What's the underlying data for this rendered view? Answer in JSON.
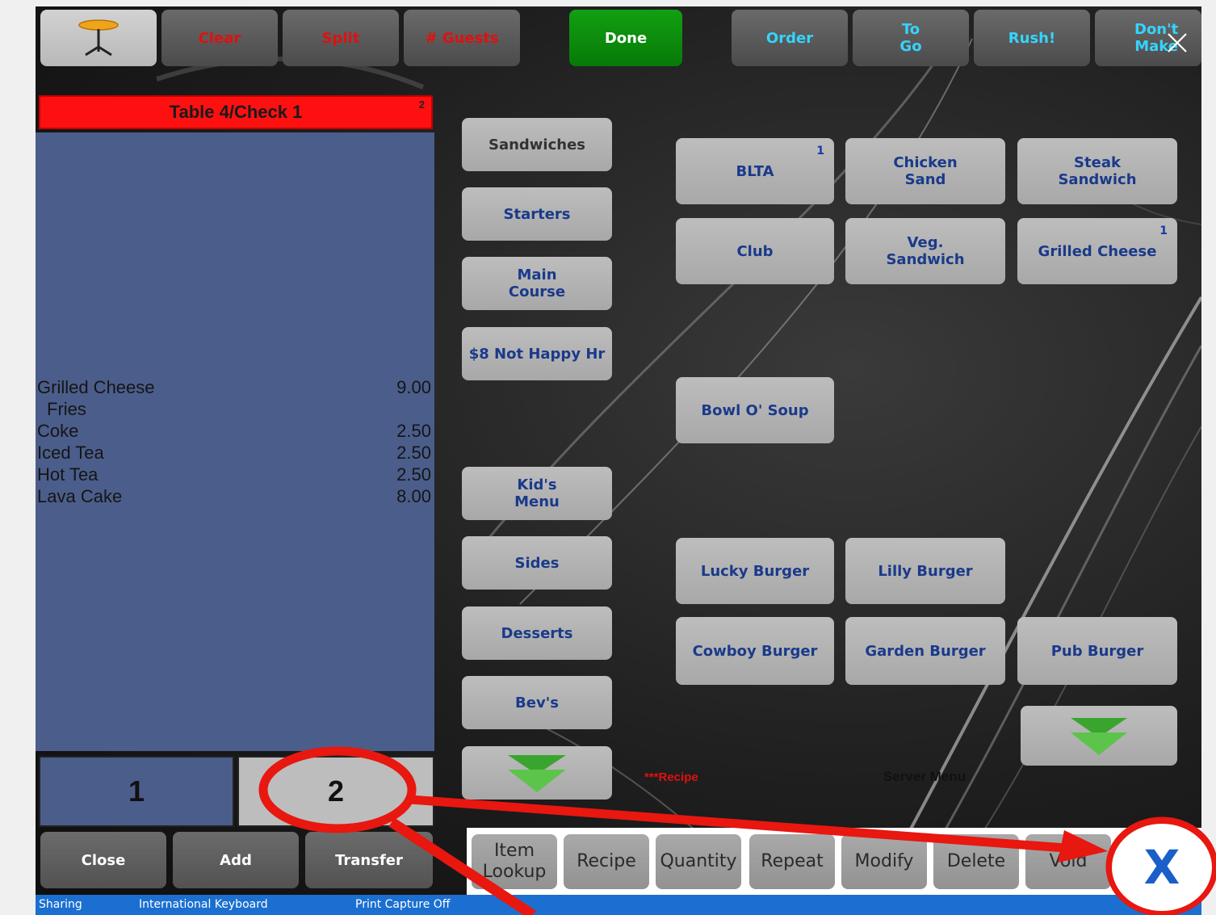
{
  "top_bar": {
    "clear": "Clear",
    "split": "Split",
    "guests": "# Guests",
    "done": "Done",
    "order": "Order",
    "to_go": "To\nGo",
    "rush": "Rush!",
    "dont_make": "Don't\nMake"
  },
  "check": {
    "title": "Table 4/Check 1",
    "seat_count": "2",
    "items": [
      {
        "name": "Grilled Cheese",
        "price": "9.00"
      },
      {
        "name": "Fries",
        "price": ""
      },
      {
        "name": "Coke",
        "price": "2.50"
      },
      {
        "name": "Iced Tea",
        "price": "2.50"
      },
      {
        "name": "Hot Tea",
        "price": "2.50"
      },
      {
        "name": "Lava Cake",
        "price": "8.00"
      }
    ],
    "seats": [
      "1",
      "2"
    ],
    "actions": {
      "close": "Close",
      "add": "Add",
      "transfer": "Transfer"
    }
  },
  "categories": [
    "Sandwiches",
    "Starters",
    "Main\nCourse",
    "$8 Not Happy Hr",
    "Kid's\nMenu",
    "Sides",
    "Desserts",
    "Bev's"
  ],
  "menu_items": {
    "blta": {
      "label": "BLTA",
      "badge": "1"
    },
    "chicken_sand": {
      "label": "Chicken\nSand"
    },
    "steak_sandwich": {
      "label": "Steak\nSandwich"
    },
    "club": {
      "label": "Club"
    },
    "veg_sandwich": {
      "label": "Veg.\nSandwich"
    },
    "grilled_cheese": {
      "label": "Grilled Cheese",
      "badge": "1"
    },
    "bowl_soup": {
      "label": "Bowl O' Soup"
    },
    "lucky_burger": {
      "label": "Lucky Burger"
    },
    "lilly_burger": {
      "label": "Lilly Burger"
    },
    "cowboy_burger": {
      "label": "Cowboy Burger"
    },
    "garden_burger": {
      "label": "Garden Burger"
    },
    "pub_burger": {
      "label": "Pub Burger"
    }
  },
  "labels": {
    "recipe": "***Recipe",
    "server_menu": "Server Menu"
  },
  "toolbar": {
    "item_lookup": "Item\nLookup",
    "recipe": "Recipe",
    "quantity": "Quantity",
    "repeat": "Repeat",
    "modify": "Modify",
    "delete": "Delete",
    "void": "Void"
  },
  "status_bar": {
    "sharing": "Sharing",
    "keyboard": "International Keyboard",
    "print_capture": "Print Capture Off"
  },
  "colors": {
    "header_red": "#ff1010",
    "check_body": "#4b5d8a",
    "done_green": "#0e8f0e",
    "button_text_blue": "#1a3a8a",
    "annotation_red": "#e8170f",
    "status_bar_blue": "#1b6fd0"
  },
  "icons": {
    "chair": "bar-stool-icon",
    "scroll_down": "double-chevron-down-icon",
    "close": "close-icon",
    "logo": "x-logo-icon"
  }
}
